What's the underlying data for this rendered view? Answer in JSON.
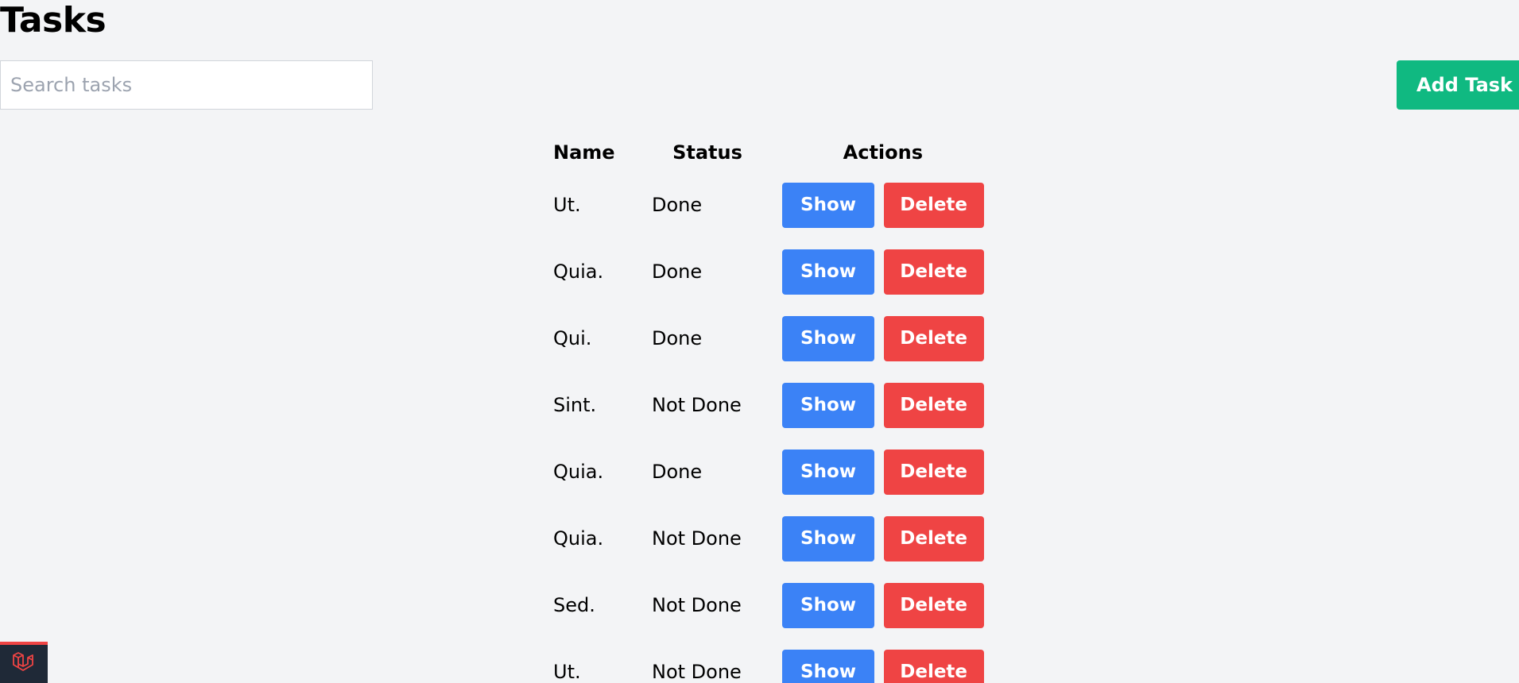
{
  "page": {
    "title": "Tasks"
  },
  "search": {
    "placeholder": "Search tasks",
    "value": ""
  },
  "toolbar": {
    "add_task_label": "Add Task"
  },
  "table": {
    "headers": {
      "name": "Name",
      "status": "Status",
      "actions": "Actions"
    },
    "rows": [
      {
        "name": "Ut.",
        "status": "Done",
        "show_label": "Show",
        "delete_label": "Delete"
      },
      {
        "name": "Quia.",
        "status": "Done",
        "show_label": "Show",
        "delete_label": "Delete"
      },
      {
        "name": "Qui.",
        "status": "Done",
        "show_label": "Show",
        "delete_label": "Delete"
      },
      {
        "name": "Sint.",
        "status": "Not Done",
        "show_label": "Show",
        "delete_label": "Delete"
      },
      {
        "name": "Quia.",
        "status": "Done",
        "show_label": "Show",
        "delete_label": "Delete"
      },
      {
        "name": "Quia.",
        "status": "Not Done",
        "show_label": "Show",
        "delete_label": "Delete"
      },
      {
        "name": "Sed.",
        "status": "Not Done",
        "show_label": "Show",
        "delete_label": "Delete"
      },
      {
        "name": "Ut.",
        "status": "Not Done",
        "show_label": "Show",
        "delete_label": "Delete"
      }
    ]
  },
  "debug_badge": {
    "icon": "laravel-logo-icon"
  },
  "colors": {
    "background": "#f3f4f6",
    "add_button": "#10b981",
    "show_button": "#3b82f6",
    "delete_button": "#ef4444",
    "badge_background": "#1f2937"
  }
}
